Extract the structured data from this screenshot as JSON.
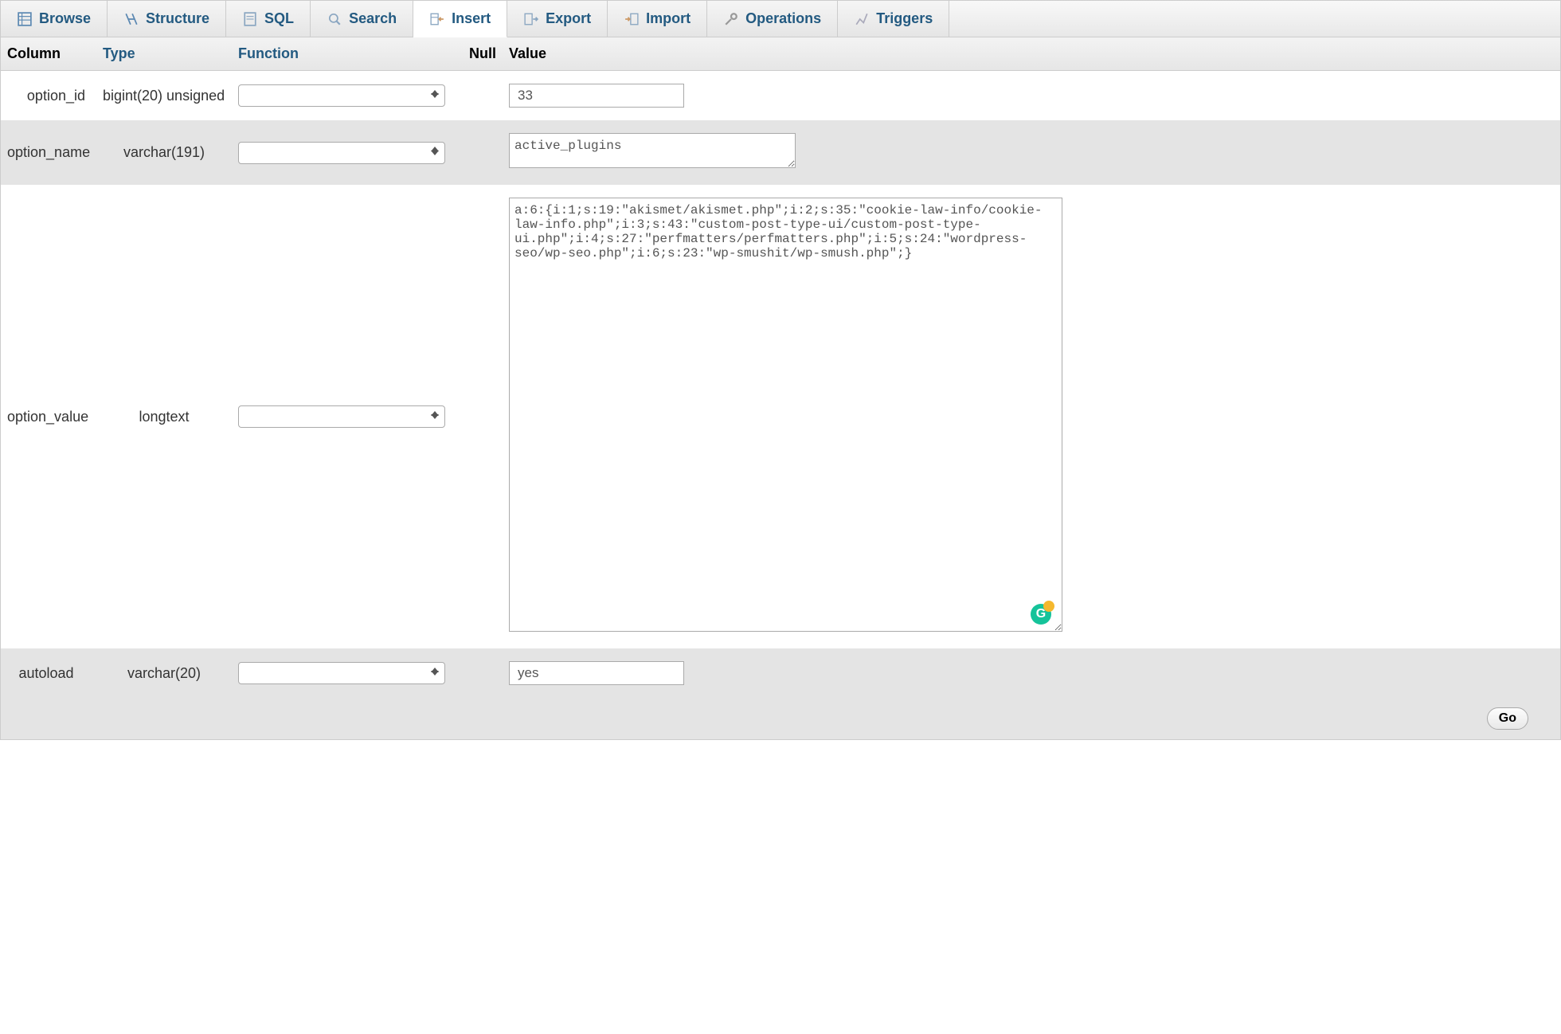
{
  "tabs": [
    {
      "label": "Browse"
    },
    {
      "label": "Structure"
    },
    {
      "label": "SQL"
    },
    {
      "label": "Search"
    },
    {
      "label": "Insert"
    },
    {
      "label": "Export"
    },
    {
      "label": "Import"
    },
    {
      "label": "Operations"
    },
    {
      "label": "Triggers"
    }
  ],
  "headers": {
    "column": "Column",
    "type": "Type",
    "function": "Function",
    "null": "Null",
    "value": "Value"
  },
  "rows": [
    {
      "column": "option_id",
      "type": "bigint(20) unsigned",
      "value": "33"
    },
    {
      "column": "option_name",
      "type": "varchar(191)",
      "value": "active_plugins"
    },
    {
      "column": "option_value",
      "type": "longtext",
      "value": "a:6:{i:1;s:19:\"akismet/akismet.php\";i:2;s:35:\"cookie-law-info/cookie-law-info.php\";i:3;s:43:\"custom-post-type-ui/custom-post-type-ui.php\";i:4;s:27:\"perfmatters/perfmatters.php\";i:5;s:24:\"wordpress-seo/wp-seo.php\";i:6;s:23:\"wp-smushit/wp-smush.php\";}"
    },
    {
      "column": "autoload",
      "type": "varchar(20)",
      "value": "yes"
    }
  ],
  "footer": {
    "go_label": "Go"
  }
}
